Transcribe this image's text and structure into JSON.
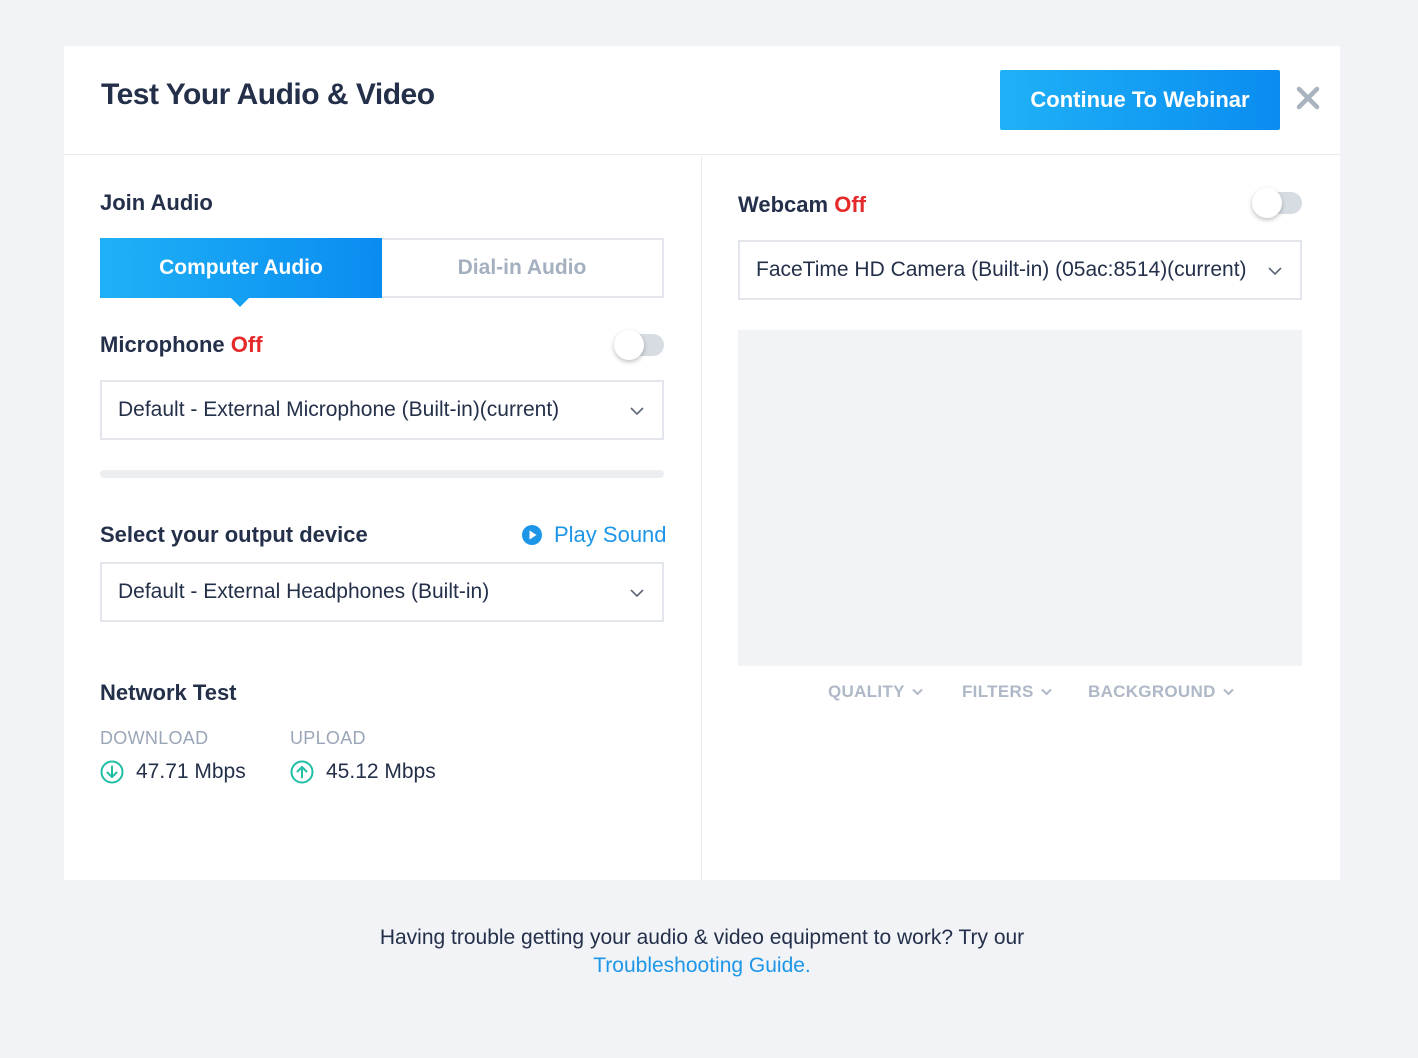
{
  "header": {
    "title": "Test Your Audio & Video",
    "continue_label": "Continue To Webinar",
    "close_icon": "close-icon"
  },
  "audio": {
    "section_title": "Join Audio",
    "tabs": [
      {
        "label": "Computer Audio",
        "active": true
      },
      {
        "label": "Dial-in Audio",
        "active": false
      }
    ],
    "microphone_label": "Microphone",
    "microphone_state": "Off",
    "microphone_enabled": false,
    "microphone_select": "Default - External Microphone (Built-in)(current)",
    "output_label": "Select your output device",
    "play_sound_label": "Play Sound",
    "output_select": "Default - External Headphones (Built-in)"
  },
  "network": {
    "title": "Network Test",
    "download_label": "DOWNLOAD",
    "download_value": "47.71 Mbps",
    "upload_label": "UPLOAD",
    "upload_value": "45.12 Mbps"
  },
  "video": {
    "webcam_label": "Webcam",
    "webcam_state": "Off",
    "webcam_enabled": false,
    "camera_select": "FaceTime HD Camera (Built-in) (05ac:8514)(current)",
    "options": [
      "QUALITY",
      "FILTERS",
      "BACKGROUND"
    ]
  },
  "footer": {
    "text": "Having trouble getting your audio & video equipment to work? Try our",
    "link": "Troubleshooting Guide."
  },
  "colors": {
    "accent": "#1e96e8",
    "off_red": "#e42a2a",
    "network_icon": "#1fbfa6"
  }
}
